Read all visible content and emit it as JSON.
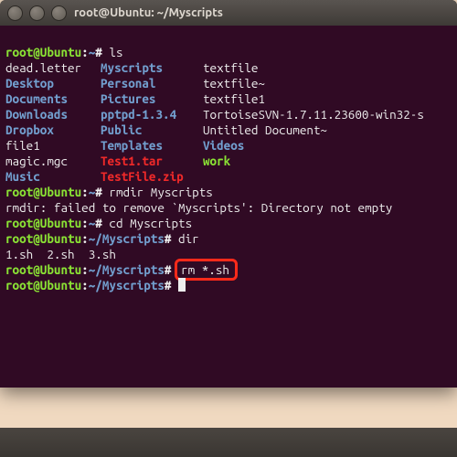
{
  "titlebar": {
    "title": "root@Ubuntu: ~/Myscripts"
  },
  "prompt": {
    "home_ls": {
      "user": "root@Ubuntu",
      "path": "~",
      "cmd": "ls"
    },
    "home_rmd": {
      "user": "root@Ubuntu",
      "path": "~",
      "cmd": "rmdir Myscripts"
    },
    "rmdir_err": "rmdir: failed to remove `Myscripts': Directory not empty",
    "home_cd": {
      "user": "root@Ubuntu",
      "path": "~",
      "cmd": "cd Myscripts"
    },
    "ms_dir": {
      "user": "root@Ubuntu",
      "path": "~/Myscripts",
      "cmd": "dir"
    },
    "dir_out": "1.sh  2.sh  3.sh",
    "ms_rm": {
      "user": "root@Ubuntu",
      "path": "~/Myscripts",
      "cmd": "rm *.sh"
    },
    "ms_empty": {
      "user": "root@Ubuntu",
      "path": "~/Myscripts",
      "cmd": ""
    }
  },
  "ls": {
    "r0": {
      "c1": "dead.letter",
      "c2": "Myscripts",
      "c3": "textfile"
    },
    "r1": {
      "c1": "Desktop",
      "c2": "Personal",
      "c3": "textfile~"
    },
    "r2": {
      "c1": "Documents",
      "c2": "Pictures",
      "c3": "textfile1"
    },
    "r3": {
      "c1": "Downloads",
      "c2": "pptpd-1.3.4",
      "c3": "TortoiseSVN-1.7.11.23600-win32-s"
    },
    "r4": {
      "c1": "Dropbox",
      "c2": "Public",
      "c3": "Untitled Document~"
    },
    "r5": {
      "c1": "file1",
      "c2": "Templates",
      "c3": "Videos"
    },
    "r6": {
      "c1": "magic.mgc",
      "c2": "Test1.tar",
      "c3": "work"
    },
    "r7": {
      "c1": "Music",
      "c2": "TestFile.zip",
      "c3": ""
    }
  }
}
